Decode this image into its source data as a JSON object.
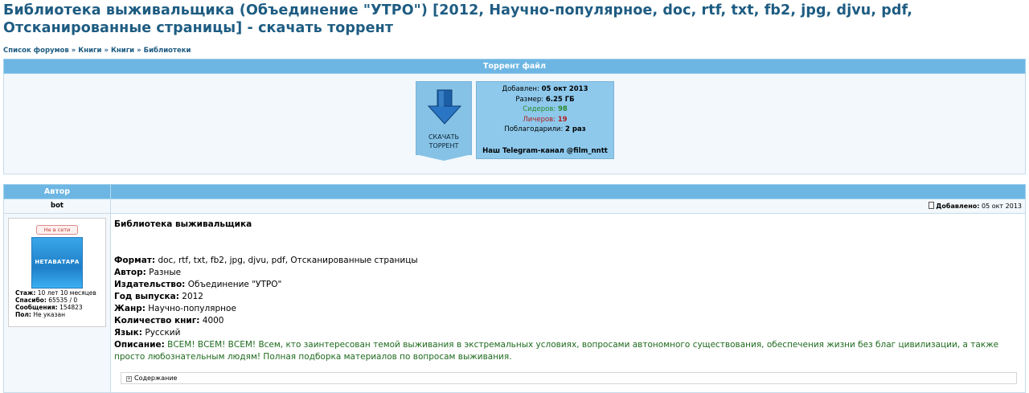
{
  "page_title": "Библиотека выживальщика (Объединение \"УТРО\") [2012, Научно-популярное, doc, rtf, txt, fb2, jpg, djvu, pdf, Отсканированные страницы] - скачать торрент",
  "breadcrumb": [
    "Список форумов",
    "Книги",
    "Книги",
    "Библиотеки"
  ],
  "breadcrumb_sep": "»",
  "torrent_file": {
    "header": "Торрент файл",
    "download_label_1": "СКАЧАТЬ",
    "download_label_2": "ТОРРЕНТ",
    "added_label": "Добавлен:",
    "added_value": "05 окт 2013",
    "size_label": "Размер:",
    "size_value": "6.25 ГБ",
    "seeders_label": "Сидеров:",
    "seeders_value": "98",
    "leechers_label": "Личеров:",
    "leechers_value": "19",
    "thanks_label": "Поблагодарили:",
    "thanks_value": "2 раз",
    "telegram": "Наш Telegram-канал @film_nntt"
  },
  "post": {
    "author_header": "Автор",
    "nickname": "bot",
    "added_label": "Добавлено:",
    "added_value": "05 окт 2013",
    "status": "Не в сети",
    "avatar_text": "НЕТАВАТАРА",
    "stats": {
      "stazh_label": "Стаж:",
      "stazh_value": "10 лет 10 месяцев",
      "spasibo_label": "Спасибо:",
      "spasibo_value": "65535 / 0",
      "messages_label": "Сообщения:",
      "messages_value": "154823",
      "gender_label": "Пол:",
      "gender_value": "Не указан"
    },
    "title": "Библиотека выживальщика",
    "fields": [
      {
        "label": "Формат:",
        "value": "doc, rtf, txt, fb2, jpg, djvu, pdf, Отсканированные страницы"
      },
      {
        "label": "Автор:",
        "value": "Разные"
      },
      {
        "label": "Издательство:",
        "value": "Объединение \"УТРО\""
      },
      {
        "label": "Год выпуска:",
        "value": "2012"
      },
      {
        "label": "Жанр:",
        "value": "Научно-популярное"
      },
      {
        "label": "Количество книг:",
        "value": "4000"
      },
      {
        "label": "Язык:",
        "value": "Русский"
      }
    ],
    "description_label": "Описание:",
    "description_value": "ВСЕМ! ВСЕМ! ВСЕМ! Всем, кто заинтересован темой выживания в экстремальных условиях, вопросами автономного существования, обеспечения жизни без благ цивилизации, а также просто любознательным людям! Полная подборка материалов по вопросам выживания.",
    "spoiler": "Содержание"
  },
  "colors": {
    "header_bar": "#6db6e3",
    "title_text": "#1e5c82",
    "seeders": "#2b8a2b",
    "leechers": "#b02020",
    "description": "#1e6a1e"
  }
}
